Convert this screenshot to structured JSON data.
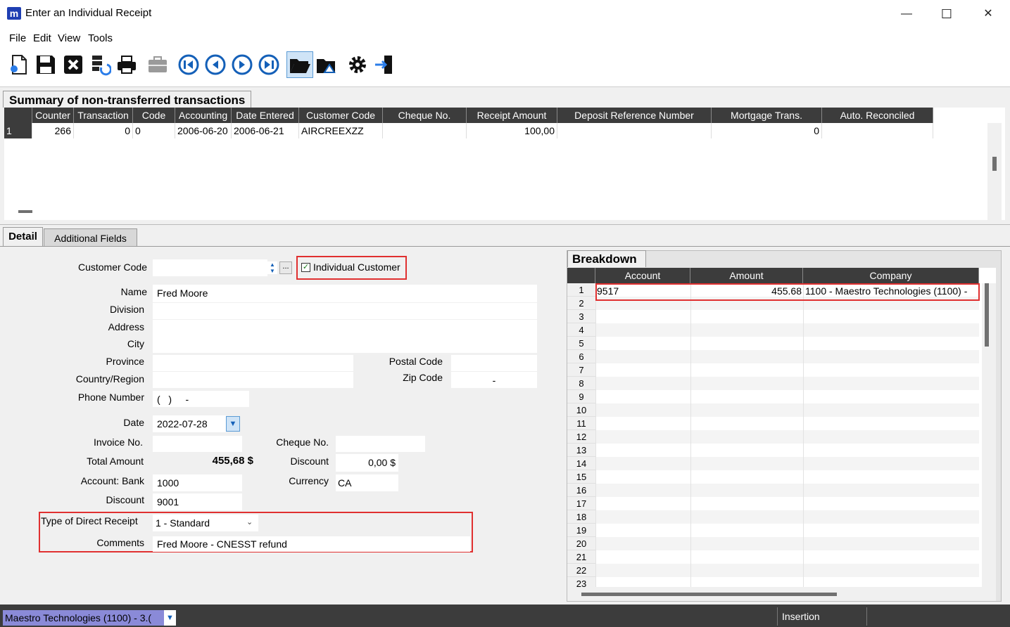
{
  "window": {
    "title": "Enter an Individual Receipt",
    "app_logo": "m",
    "minimize": "—",
    "maximize": "☐",
    "close": "✕"
  },
  "menu": [
    "File",
    "Edit",
    "View",
    "Tools"
  ],
  "toolbar_icons": [
    "new-icon",
    "save-icon",
    "delete-icon",
    "transfer-icon",
    "print-icon",
    "briefcase-icon",
    "first-icon",
    "previous-icon",
    "next-icon",
    "last-icon",
    "open-folder-icon",
    "folder-search-icon",
    "settings-icon",
    "exit-icon"
  ],
  "summary": {
    "title": "Summary of non-transferred transactions",
    "columns": [
      "Counter",
      "Transaction",
      "Code",
      "Accounting",
      "Date Entered",
      "Customer Code",
      "Cheque No.",
      "Receipt Amount",
      "Deposit Reference Number",
      "Mortgage Trans.",
      "Auto. Reconciled"
    ],
    "rows": [
      {
        "row": "1",
        "counter": "266",
        "transaction": "0",
        "code": "0",
        "accounting": "2006-06-20",
        "date_entered": "2006-06-21",
        "customer_code": "AIRCREEXZZ",
        "cheque_no": "",
        "receipt_amount": "100,00",
        "deposit_ref": "",
        "mortgage": "0",
        "auto_reconciled": ""
      }
    ]
  },
  "tabs": {
    "detail": "Detail",
    "additional": "Additional Fields"
  },
  "detail": {
    "customer_code_label": "Customer Code",
    "customer_code_value": "",
    "lookup_button": "...",
    "individual_customer_label": "Individual Customer",
    "individual_customer_checked": "✓",
    "name_label": "Name",
    "name_value": "Fred Moore",
    "division_label": "Division",
    "division_value": "",
    "address_label": "Address",
    "address_value": "",
    "city_label": "City",
    "city_value": "",
    "province_label": "Province",
    "province_value": "",
    "postal_code_label": "Postal Code",
    "postal_code_value": "",
    "country_label": "Country/Region",
    "country_value": "",
    "zip_code_label": "Zip Code",
    "zip_code_value": "-",
    "phone_label": "Phone Number",
    "phone_value": "(   )     -",
    "date_label": "Date",
    "date_value": "2022-07-28",
    "invoice_label": "Invoice No.",
    "invoice_value": "",
    "cheque_label": "Cheque No.",
    "cheque_value": "",
    "total_label": "Total Amount",
    "total_value": "455,68 $",
    "discount_amount_label": "Discount",
    "discount_amount_value": "0,00 $",
    "bank_label": "Account: Bank",
    "bank_value": "1000",
    "currency_label": "Currency",
    "currency_value": "CA",
    "discount_account_label": "Discount",
    "discount_account_value": "9001",
    "type_label": "Type of Direct Receipt",
    "type_value": "1 - Standard",
    "comments_label": "Comments",
    "comments_value": "Fred Moore - CNESST refund"
  },
  "breakdown": {
    "title": "Breakdown",
    "columns": [
      "Account",
      "Amount",
      "Company"
    ],
    "first_row": {
      "account": "9517",
      "amount": "455.68",
      "company": "1100 - Maestro Technologies (1100)  -"
    },
    "row_numbers": [
      "1",
      "2",
      "3",
      "4",
      "5",
      "6",
      "7",
      "8",
      "9",
      "10",
      "11",
      "12",
      "13",
      "14",
      "15",
      "16",
      "17",
      "18",
      "19",
      "20",
      "21",
      "22",
      "23"
    ]
  },
  "status": {
    "company": "Maestro Technologies (1100) - 3.(",
    "mode": "Insertion"
  },
  "colors": {
    "accent_red": "#e03030",
    "header_dark": "#3c3c3c",
    "status_company_bg": "#8a8ad8"
  }
}
